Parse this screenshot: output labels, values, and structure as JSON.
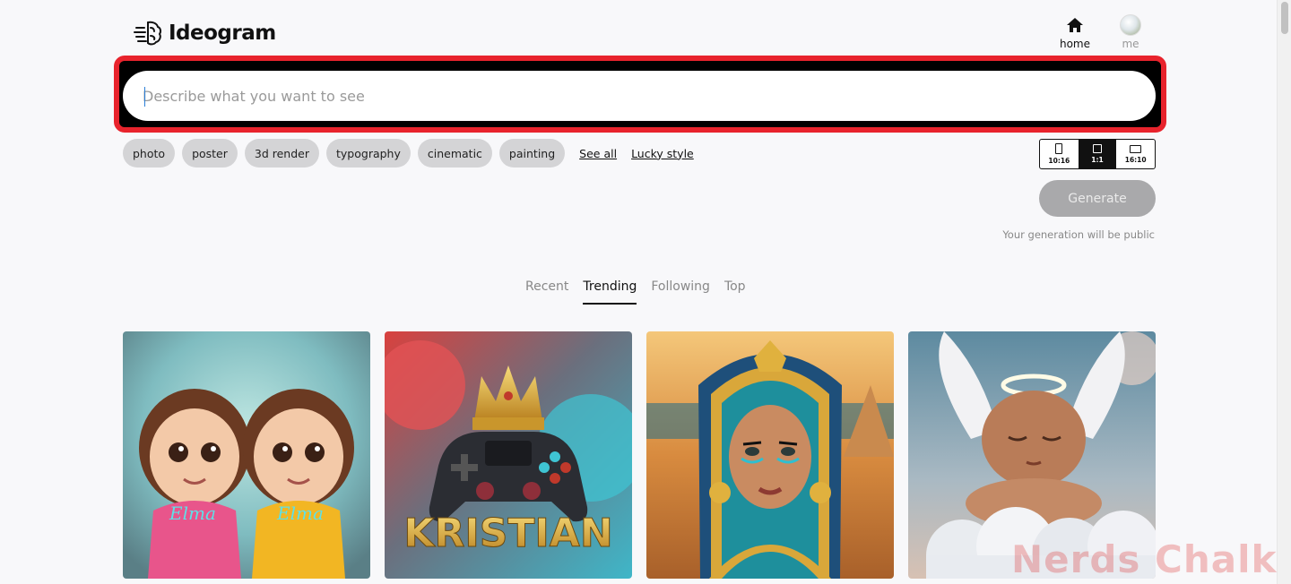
{
  "brand": {
    "name": "Ideogram"
  },
  "nav": {
    "home_label": "home",
    "me_label": "me"
  },
  "prompt": {
    "placeholder": "Describe what you want to see",
    "value": ""
  },
  "style_chips": [
    "photo",
    "poster",
    "3d render",
    "typography",
    "cinematic",
    "painting"
  ],
  "links": {
    "see_all": "See all",
    "lucky_style": "Lucky style"
  },
  "aspect_ratios": [
    {
      "label": "10:16",
      "active": false
    },
    {
      "label": "1:1",
      "active": true
    },
    {
      "label": "16:10",
      "active": false
    }
  ],
  "generate": {
    "label": "Generate",
    "note": "Your generation will be public"
  },
  "tabs": [
    {
      "label": "Recent",
      "active": false
    },
    {
      "label": "Trending",
      "active": true
    },
    {
      "label": "Following",
      "active": false
    },
    {
      "label": "Top",
      "active": false
    }
  ],
  "gallery": [
    {
      "name": "twin-girls-hoodies-image",
      "text": "Elma"
    },
    {
      "name": "game-controller-crown-image",
      "text": "KRISTIAN"
    },
    {
      "name": "egyptian-queen-image",
      "text": ""
    },
    {
      "name": "sleeping-baby-angel-image",
      "text": ""
    }
  ],
  "watermark": "Nerds Chalk",
  "colors": {
    "highlight_border": "#e8232c",
    "chip_bg": "#d4d4d6",
    "generate_bg": "#a9a9ab"
  }
}
